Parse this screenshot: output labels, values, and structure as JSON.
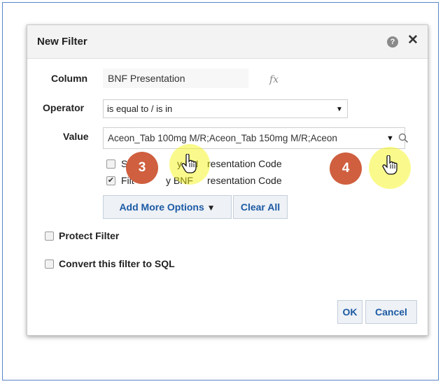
{
  "dialog": {
    "title": "New Filter",
    "help_glyph": "?",
    "close_glyph": "✕"
  },
  "form": {
    "column_label": "Column",
    "column_value": "BNF Presentation",
    "fx_glyph": "fx",
    "operator_label": "Operator",
    "operator_value": "is equal to / is in",
    "value_label": "Value",
    "value_text": "Aceon_Tab 100mg M/R;Aceon_Tab 150mg M/R;Aceon",
    "option1_label": "Show Presentation Code... hidden: Sort by BNF Presentation Code",
    "option1_visible_left": "S",
    "option1_visible_mid": "y BN",
    "option1_visible_right": "resentation Code",
    "option1_checked": false,
    "option2_visible_left": "Filt",
    "option2_visible_mid": "y BNF ",
    "option2_visible_right": "resentation Code",
    "option2_checked": true,
    "add_more_options_label": "Add More Options",
    "add_more_arrow": "▼",
    "clear_all_label": "Clear All",
    "protect_filter_label": "Protect Filter",
    "convert_sql_label": "Convert this filter to SQL"
  },
  "footer": {
    "ok_label": "OK",
    "cancel_label": "Cancel"
  },
  "annotations": {
    "step3": "3",
    "step4": "4",
    "badge_color": "#cf5f3f",
    "highlight_color": "#f5f500"
  },
  "icons": {
    "help": "help-icon",
    "close": "close-icon",
    "search": "search-icon",
    "dropdown": "chevron-down-icon",
    "cursor": "hand-cursor-icon"
  }
}
